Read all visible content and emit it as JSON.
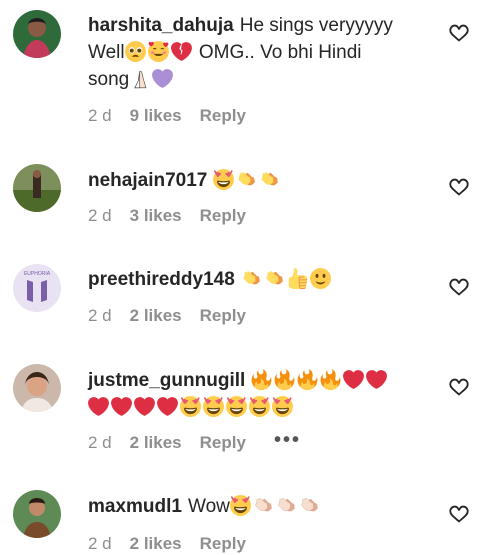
{
  "comments": [
    {
      "username": "harshita_dahuja",
      "text1": "He sings veryyyyy",
      "text2": "Well",
      "text3": "OMG.. Vo bhi Hindi",
      "text4": "song",
      "time": "2 d",
      "likes": "9 likes",
      "reply": "Reply"
    },
    {
      "username": "nehajain7017",
      "time": "2 d",
      "likes": "3 likes",
      "reply": "Reply"
    },
    {
      "username": "preethireddy148",
      "avatar_text": "EUPHORIA",
      "time": "2 d",
      "likes": "2 likes",
      "reply": "Reply"
    },
    {
      "username": "justme_gunnugill",
      "time": "2 d",
      "likes": "2 likes",
      "reply": "Reply",
      "more": "•••"
    },
    {
      "username": "maxmudl1",
      "text1": "Wow",
      "time": "2 d",
      "likes": "2 likes",
      "reply": "Reply"
    }
  ],
  "icons": {
    "like": "heart-outline-icon",
    "more": "more-options-icon"
  },
  "colors": {
    "text": "#262626",
    "muted": "#8e8e8e",
    "heart_red": "#e0245e",
    "fire": "#f4900c",
    "clap": "#ffcc4d",
    "purple_heart": "#aa8ed6"
  }
}
